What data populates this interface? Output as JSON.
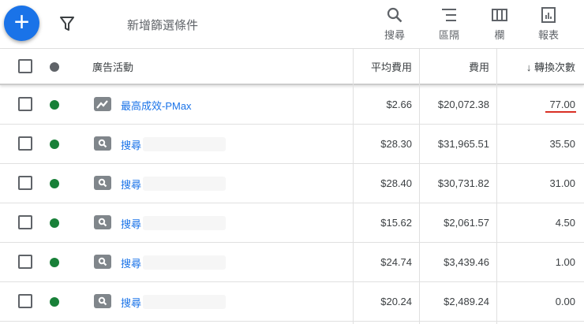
{
  "toolbar": {
    "filter_placeholder": "新增篩選條件",
    "tools": [
      "搜尋",
      "區隔",
      "欄",
      "報表"
    ]
  },
  "header": {
    "campaign": "廣告活動",
    "avg_cost": "平均費用",
    "cost": "費用",
    "conversions": "↓ 轉換次數"
  },
  "rows": [
    {
      "name": "最高成效-PMax",
      "type": "pmax",
      "avg_cost": "$2.66",
      "cost": "$20,072.38",
      "conversions": "77.00"
    },
    {
      "name": "搜尋",
      "type": "search",
      "avg_cost": "$28.30",
      "cost": "$31,965.51",
      "conversions": "35.50"
    },
    {
      "name": "搜尋",
      "type": "search",
      "avg_cost": "$28.40",
      "cost": "$30,731.82",
      "conversions": "31.00"
    },
    {
      "name": "搜尋",
      "type": "search",
      "avg_cost": "$15.62",
      "cost": "$2,061.57",
      "conversions": "4.50"
    },
    {
      "name": "搜尋",
      "type": "search",
      "avg_cost": "$24.74",
      "cost": "$3,439.46",
      "conversions": "1.00"
    },
    {
      "name": "搜尋",
      "type": "search",
      "avg_cost": "$20.24",
      "cost": "$2,489.24",
      "conversions": "0.00"
    }
  ],
  "colors": {
    "accent": "#1a73e8",
    "enabled": "#188038",
    "underline": "#d93025"
  }
}
